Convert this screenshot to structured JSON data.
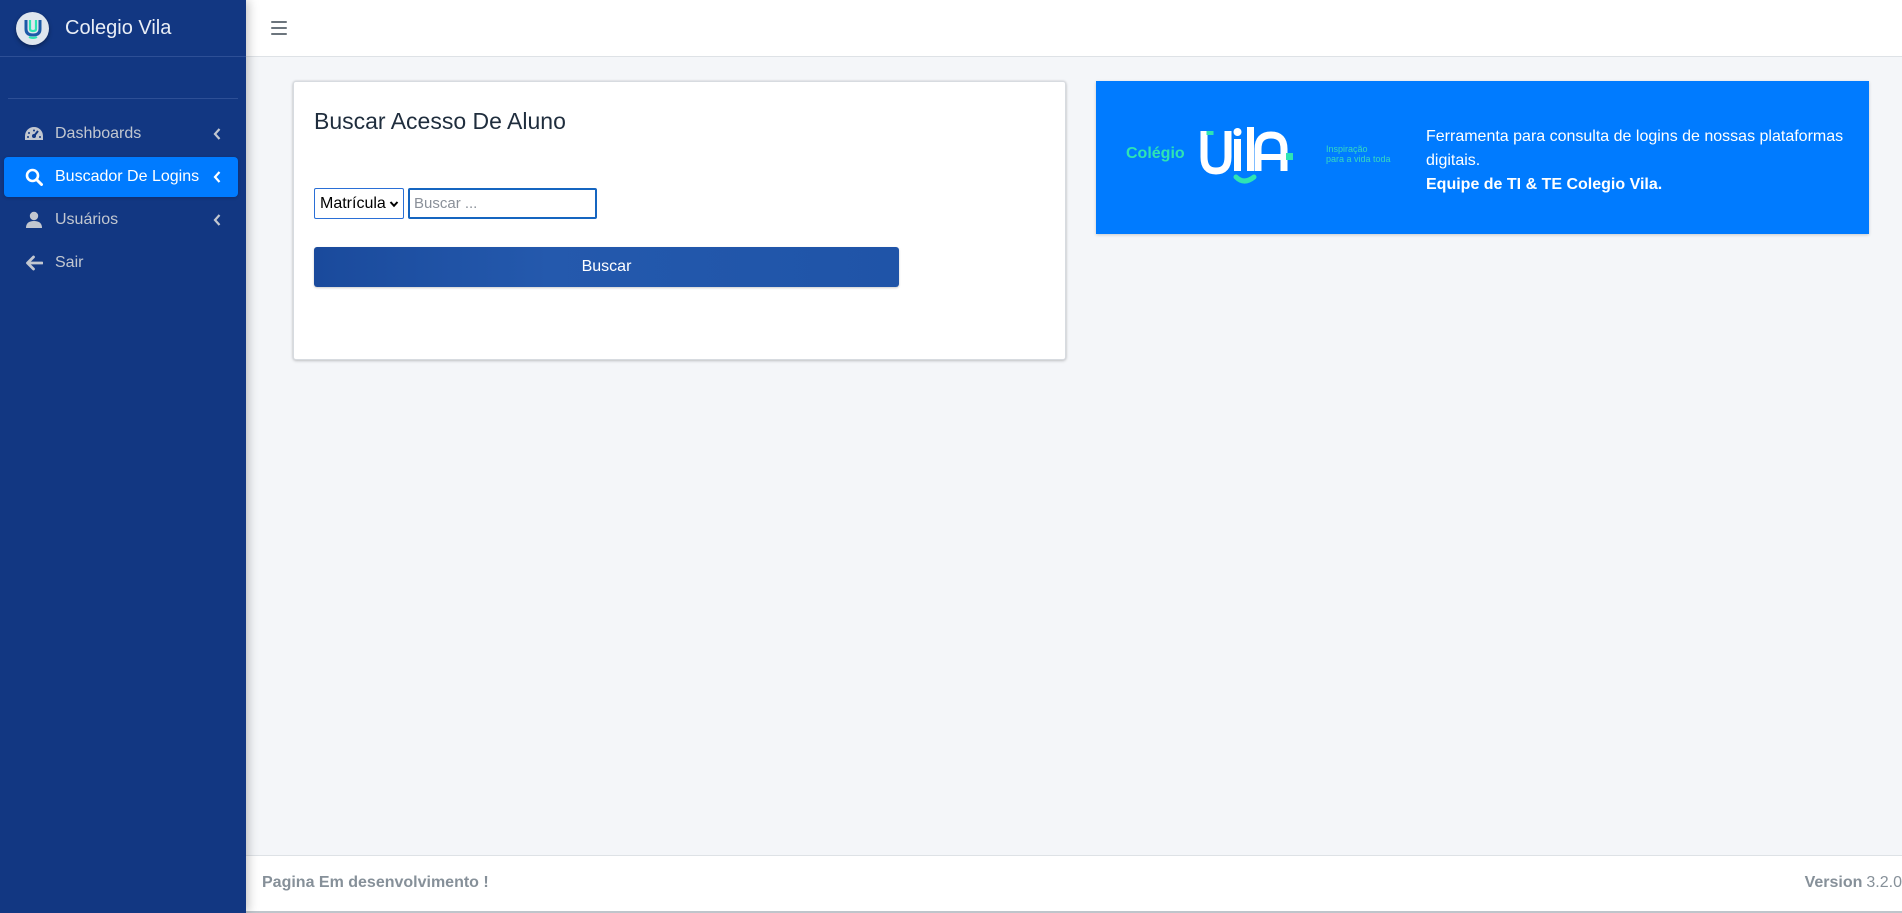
{
  "brand": {
    "name": "Colegio Vila",
    "logo_icon": "vila-v-logo-icon"
  },
  "topbar": {
    "menu_icon": "hamburger-icon"
  },
  "sidebar": {
    "items": [
      {
        "label": "Dashboards",
        "icon": "tachometer-icon",
        "has_chevron": true,
        "active": false
      },
      {
        "label": "Buscador De Logins",
        "icon": "search-icon",
        "has_chevron": true,
        "active": true
      },
      {
        "label": "Usuários",
        "icon": "user-icon",
        "has_chevron": true,
        "active": false
      },
      {
        "label": "Sair",
        "icon": "arrow-left-icon",
        "has_chevron": false,
        "active": false
      }
    ]
  },
  "search_card": {
    "title": "Buscar Acesso De Aluno",
    "select_value": "Matrícula",
    "input_placeholder": "Buscar ...",
    "input_value": "",
    "button_label": "Buscar"
  },
  "banner": {
    "logo_colegio": "Colégio",
    "logo_tagline_1": "Inspiração",
    "logo_tagline_2": "para a vida toda",
    "description": "Ferramenta para consulta de logins de nossas plataformas digitais.",
    "signature": "Equipe de TI & TE Colegio Vila.",
    "background_color": "#007bff",
    "accent_color": "#2ee4b3"
  },
  "footer": {
    "status": "Pagina Em desenvolvimento !",
    "version_label": "Version",
    "version_number": "3.2.0"
  },
  "colors": {
    "sidebar_bg": "#123782",
    "active_item": "#007bff",
    "button_bg": "#1f54a8",
    "page_bg": "#f4f6f9"
  }
}
